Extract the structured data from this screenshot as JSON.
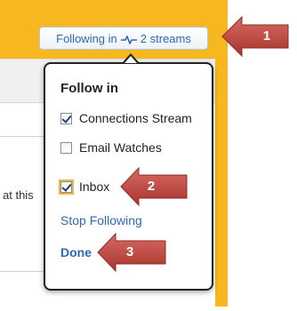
{
  "button": {
    "following_prefix": "Following in",
    "following_suffix": "2 streams",
    "icon": "stream-pulse-icon"
  },
  "background": {
    "fragment_text": "at this"
  },
  "popup": {
    "title": "Follow in",
    "options": [
      {
        "label": "Connections Stream",
        "checked": true
      },
      {
        "label": "Email Watches",
        "checked": false
      },
      {
        "label": "Inbox",
        "checked": true
      }
    ],
    "stop_following": "Stop Following",
    "done": "Done"
  },
  "callouts": [
    {
      "number": "1"
    },
    {
      "number": "2"
    },
    {
      "number": "3"
    }
  ],
  "colors": {
    "page_background": "#f6b81e",
    "link": "#2b6ab3",
    "callout_fill": "#b94a44"
  }
}
